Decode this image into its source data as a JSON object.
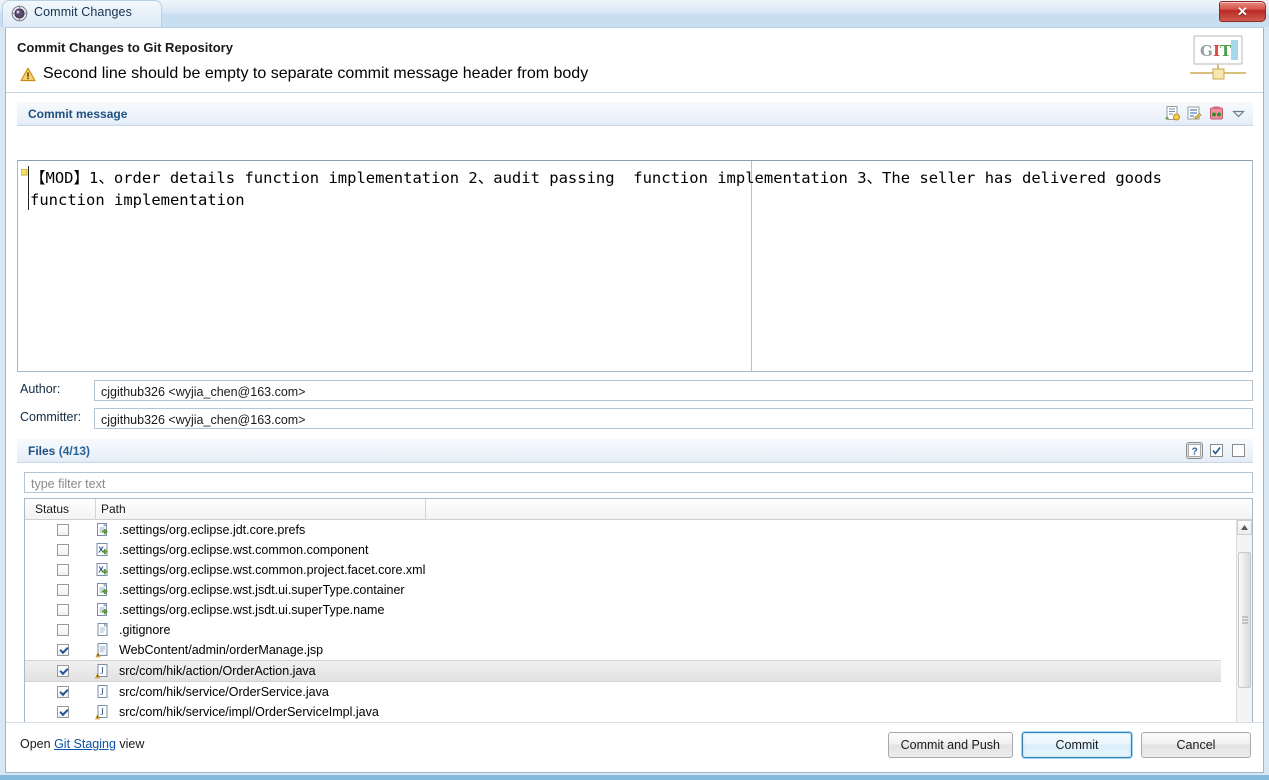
{
  "window": {
    "title": "Commit Changes",
    "title_icon": "commit-changes-icon",
    "close_label": "✕"
  },
  "header": {
    "heading": "Commit Changes to Git Repository",
    "warning_icon": "warning-triangle-icon",
    "warning_text": "Second line should be empty to separate commit message header from body",
    "logo": "git-logo",
    "logo_text": "GIT"
  },
  "commit_message_section": {
    "title": "Commit message",
    "tools": [
      {
        "name": "amend-previous-commit-icon",
        "tooltip": "Amend previous commit"
      },
      {
        "name": "add-signed-off-by-icon",
        "tooltip": "Add Signed-off-by"
      },
      {
        "name": "add-change-id-icon",
        "tooltip": "Add Change-Id"
      },
      {
        "name": "chevron-down-icon",
        "tooltip": "More"
      }
    ],
    "text": "【MOD】1、order details function implementation 2、audit passing  function implementation 3、The seller has delivered goods function implementation"
  },
  "fields": {
    "author_label": "Author:",
    "author_value": "cjgithub326 <wyjia_chen@163.com>",
    "committer_label": "Committer:",
    "committer_value": "cjgithub326 <wyjia_chen@163.com>"
  },
  "files_section": {
    "title_bold": "Files",
    "title_count": "(4/13)",
    "tools": [
      {
        "name": "show-untracked-files-icon",
        "label": "?"
      },
      {
        "name": "select-all-icon",
        "label": "☑"
      },
      {
        "name": "deselect-all-icon",
        "label": "☐"
      }
    ],
    "filter_placeholder": "type filter text",
    "filter_value": "",
    "columns": [
      {
        "name": "status",
        "label": "Status"
      },
      {
        "name": "path",
        "label": "Path"
      }
    ],
    "rows": [
      {
        "checked": false,
        "icon": "file-added-icon",
        "path": ".settings/org.eclipse.jdt.core.prefs",
        "selected": false
      },
      {
        "checked": false,
        "icon": "xml-file-added-icon",
        "path": ".settings/org.eclipse.wst.common.component",
        "selected": false
      },
      {
        "checked": false,
        "icon": "xml-file-added-icon",
        "path": ".settings/org.eclipse.wst.common.project.facet.core.xml",
        "selected": false
      },
      {
        "checked": false,
        "icon": "file-added-icon",
        "path": ".settings/org.eclipse.wst.jsdt.ui.superType.container",
        "selected": false
      },
      {
        "checked": false,
        "icon": "file-added-icon",
        "path": ".settings/org.eclipse.wst.jsdt.ui.superType.name",
        "selected": false
      },
      {
        "checked": false,
        "icon": "plain-file-icon",
        "path": ".gitignore",
        "selected": false
      },
      {
        "checked": true,
        "icon": "jsp-file-modified-icon",
        "path": "WebContent/admin/orderManage.jsp",
        "selected": false
      },
      {
        "checked": true,
        "icon": "java-file-modified-icon",
        "path": "src/com/hik/action/OrderAction.java",
        "selected": true
      },
      {
        "checked": true,
        "icon": "java-file-icon",
        "path": "src/com/hik/service/OrderService.java",
        "selected": false
      },
      {
        "checked": true,
        "icon": "java-file-modified-icon",
        "path": "src/com/hik/service/impl/OrderServiceImpl.java",
        "selected": false
      }
    ]
  },
  "footer": {
    "open_prefix": "Open ",
    "open_link": "Git Staging",
    "open_suffix": " view",
    "buttons": [
      {
        "name": "commit-and-push-button",
        "label": "Commit and Push",
        "default": false
      },
      {
        "name": "commit-button",
        "label": "Commit",
        "default": true
      },
      {
        "name": "cancel-button",
        "label": "Cancel",
        "default": false
      }
    ]
  },
  "colors": {
    "section_title": "#1f5080",
    "link": "#0a54a8",
    "warning": "#f0ad2e",
    "default_button_border": "#3c7fb1"
  }
}
